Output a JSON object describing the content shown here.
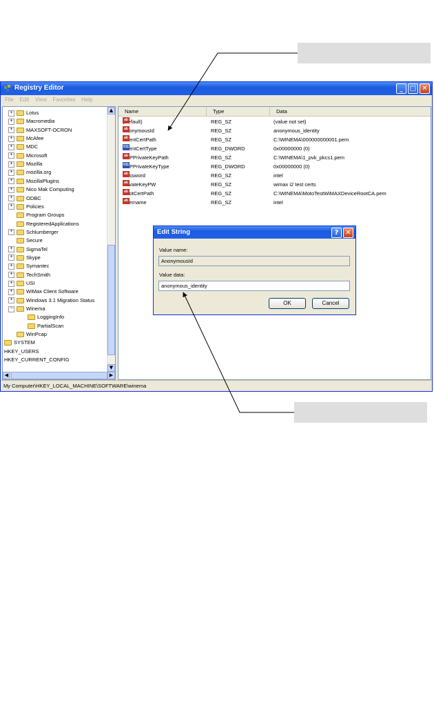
{
  "window": {
    "title": "Registry Editor",
    "menu": [
      "File",
      "Edit",
      "View",
      "Favorites",
      "Help"
    ],
    "status_path": "My Computer\\HKEY_LOCAL_MACHINE\\SOFTWARE\\winema"
  },
  "tree": {
    "items": [
      {
        "label": "Lotus",
        "expandable": true
      },
      {
        "label": "Macromedia",
        "expandable": true
      },
      {
        "label": "MAXSOFT-OCRON",
        "expandable": true
      },
      {
        "label": "McAfee",
        "expandable": true
      },
      {
        "label": "MDC",
        "expandable": true
      },
      {
        "label": "Microsoft",
        "expandable": true
      },
      {
        "label": "Mozilla",
        "expandable": true
      },
      {
        "label": "mozilla.org",
        "expandable": true
      },
      {
        "label": "MozillaPlugins",
        "expandable": true
      },
      {
        "label": "Nico Mak Computing",
        "expandable": true
      },
      {
        "label": "ODBC",
        "expandable": true
      },
      {
        "label": "Policies",
        "expandable": true
      },
      {
        "label": "Program Groups",
        "expandable": false
      },
      {
        "label": "RegisteredApplications",
        "expandable": false
      },
      {
        "label": "Schlumberger",
        "expandable": true
      },
      {
        "label": "Secure",
        "expandable": false
      },
      {
        "label": "SigmaTel",
        "expandable": true
      },
      {
        "label": "Skype",
        "expandable": true
      },
      {
        "label": "Symantec",
        "expandable": true
      },
      {
        "label": "TechSmith",
        "expandable": true
      },
      {
        "label": "USI",
        "expandable": true
      },
      {
        "label": "WiMax Client Software",
        "expandable": true
      },
      {
        "label": "Windows 3.1 Migration Status",
        "expandable": true
      },
      {
        "label": "Winema",
        "expandable": true
      },
      {
        "label": "LoggingInfo",
        "expandable": false
      },
      {
        "label": "PartialScan",
        "expandable": false
      },
      {
        "label": "WinPcap",
        "expandable": false
      }
    ],
    "roots": [
      "SYSTEM",
      "HKEY_USERS",
      "HKEY_CURRENT_CONFIG"
    ]
  },
  "list": {
    "columns": [
      "Name",
      "Type",
      "Data"
    ],
    "rows": [
      {
        "name": "(Default)",
        "type": "REG_SZ",
        "data": "(value not set)",
        "icon": "string-value-icon"
      },
      {
        "name": "AnonymousId",
        "type": "REG_SZ",
        "data": "anonymous_identity",
        "icon": "string-value-icon"
      },
      {
        "name": "ClientCertPath",
        "type": "REG_SZ",
        "data": "C:\\WINEMA\\000000000001.pem",
        "icon": "string-value-icon"
      },
      {
        "name": "ClientCertType",
        "type": "REG_DWORD",
        "data": "0x00000000 (0)",
        "icon": "dword-value-icon"
      },
      {
        "name": "EAPPrivateKeyPath",
        "type": "REG_SZ",
        "data": "C:\\WINEMA\\1_pvk_pkcs1.pem",
        "icon": "string-value-icon"
      },
      {
        "name": "EAPPrivateKeyType",
        "type": "REG_DWORD",
        "data": "0x00000000 (0)",
        "icon": "dword-value-icon"
      },
      {
        "name": "Password",
        "type": "REG_SZ",
        "data": "intel",
        "icon": "string-value-icon"
      },
      {
        "name": "PrivateKeyPW",
        "type": "REG_SZ",
        "data": "wimax i2 test certs",
        "icon": "string-value-icon"
      },
      {
        "name": "RootCertPath",
        "type": "REG_SZ",
        "data": "C:\\WINEMA\\MotoTestWiMAXDeviceRootCA.pem",
        "icon": "string-value-icon"
      },
      {
        "name": "Username",
        "type": "REG_SZ",
        "data": "intel",
        "icon": "string-value-icon"
      }
    ]
  },
  "dialog": {
    "title": "Edit String",
    "value_name_label": "Value name:",
    "value_name": "AnonymousId",
    "value_data_label": "Value data:",
    "value_data": "anonymous_identity",
    "ok_label": "OK",
    "cancel_label": "Cancel",
    "help_glyph": "?",
    "close_glyph": "✕"
  },
  "icon_labels": {
    "string": "ab",
    "dword": "011"
  }
}
